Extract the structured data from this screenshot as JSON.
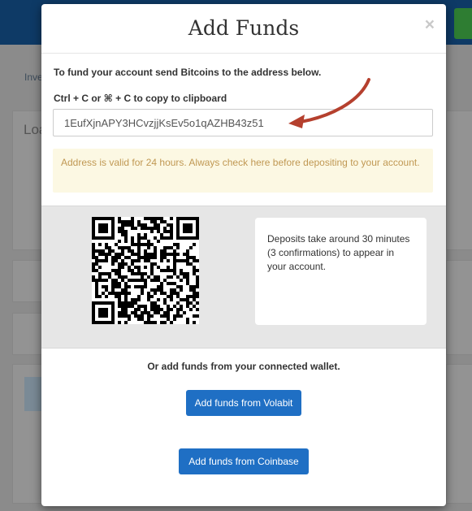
{
  "background": {
    "nav_link": "Inve",
    "panel_heading": "Loa"
  },
  "modal": {
    "title": "Add Funds",
    "close_symbol": "×",
    "instruction": "To fund your account send Bitcoins to the address below.",
    "copy_hint": "Ctrl + C or ⌘ + C to copy to clipboard",
    "address": "1EufXjnAPY3HCvzjjKsEv5o1qAZHB43z51",
    "validity_notice": "Address is valid for 24 hours. Always check here before depositing to your account.",
    "deposit_info": "Deposits take around 30 minutes (3 confirmations) to appear in your account.",
    "connected_wallet_label": "Or add funds from your connected wallet.",
    "buttons": {
      "volabit": "Add funds from Volabit",
      "coinbase": "Add funds from Coinbase"
    }
  },
  "colors": {
    "primary_button": "#1f6fc4",
    "warning_bg": "#fcf8e3",
    "warning_text": "#c09853",
    "annotation_arrow": "#b5402e"
  },
  "icons": [
    "close-icon",
    "qr-code",
    "annotation-arrow"
  ]
}
